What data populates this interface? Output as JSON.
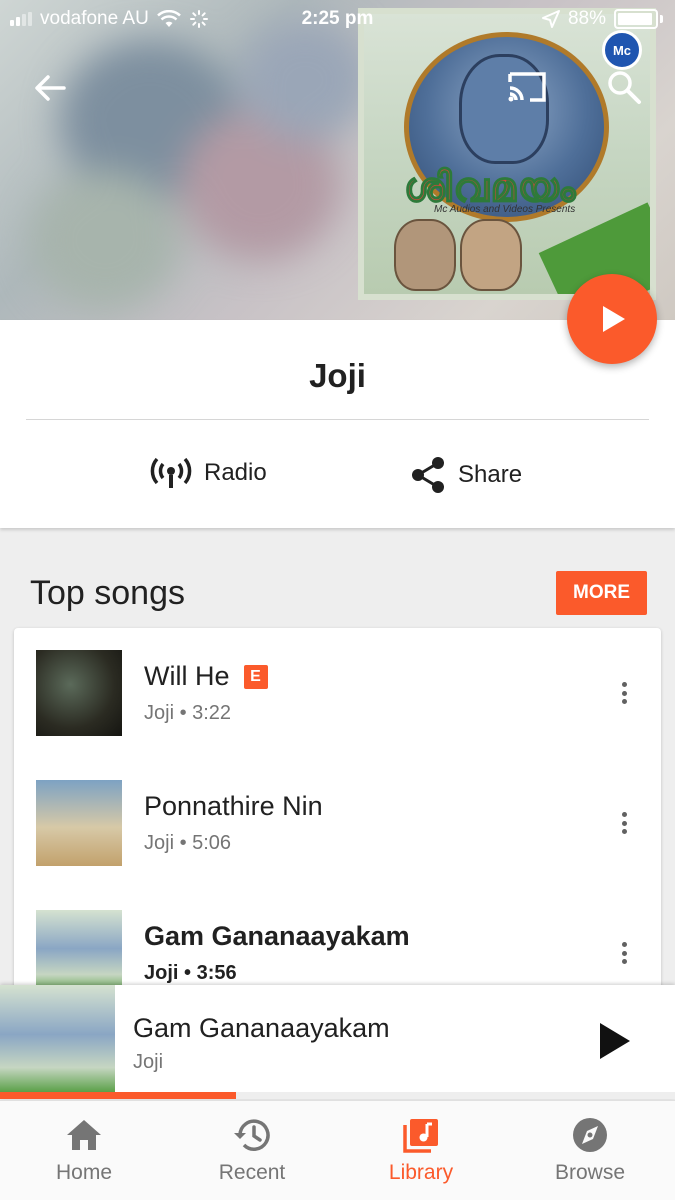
{
  "status_bar": {
    "carrier": "vodafone AU",
    "time": "2:25 pm",
    "battery": "88%"
  },
  "artist": {
    "name": "Joji",
    "radio_label": "Radio",
    "share_label": "Share"
  },
  "cover": {
    "title": "ശിവമയം",
    "subtitle": "Mc Audios and Videos Presents",
    "logo": "Mc"
  },
  "top_songs": {
    "title": "Top songs",
    "more_label": "MORE",
    "songs": [
      {
        "title": "Will He",
        "explicit": "E",
        "subtitle": "Joji • 3:22"
      },
      {
        "title": "Ponnathire Nin",
        "subtitle": "Joji • 5:06"
      },
      {
        "title": "Gam Gananaayakam",
        "subtitle": "Joji • 3:56"
      }
    ]
  },
  "now_playing": {
    "title": "Gam Gananaayakam",
    "artist": "Joji",
    "progress": 0.35
  },
  "bottom_nav": {
    "items": [
      {
        "label": "Home",
        "icon": "home-icon"
      },
      {
        "label": "Recent",
        "icon": "history-icon"
      },
      {
        "label": "Library",
        "icon": "library-icon",
        "active": true
      },
      {
        "label": "Browse",
        "icon": "compass-icon"
      }
    ]
  },
  "colors": {
    "accent": "#fb5a2b",
    "text": "#212121",
    "secondary_text": "#757575"
  }
}
